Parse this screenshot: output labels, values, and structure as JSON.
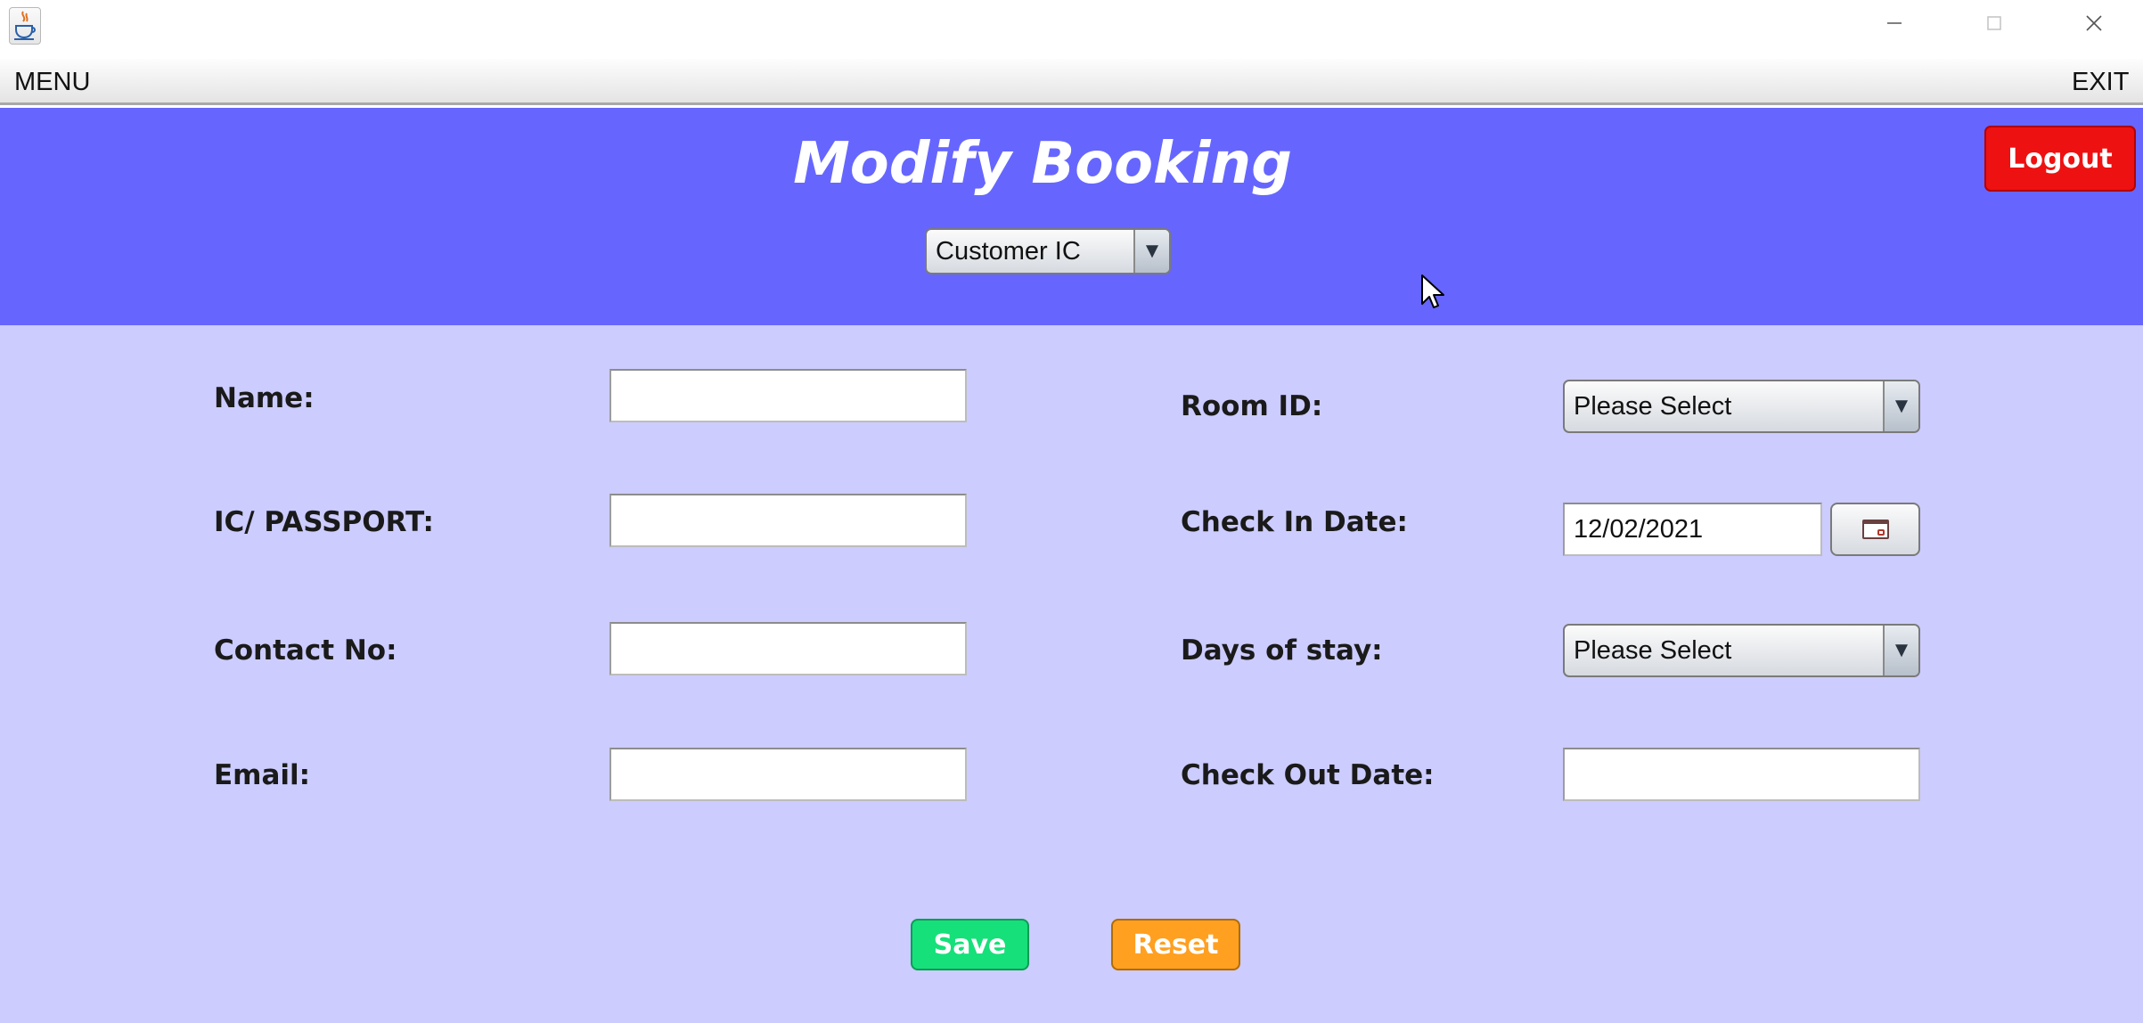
{
  "window": {
    "app_icon": "java-coffee-cup-icon",
    "controls": {
      "minimize": "—",
      "maximize": "☐",
      "close": "✕"
    }
  },
  "menubar": {
    "menu_label": "MENU",
    "exit_label": "EXIT"
  },
  "header": {
    "title": "Modify Booking",
    "logout_label": "Logout",
    "search_type_selected": "Customer IC",
    "bg_color": "#6666ff"
  },
  "form": {
    "bg_color": "#ccccff",
    "name": {
      "label": "Name:",
      "value": ""
    },
    "ic_passport": {
      "label": "IC/ PASSPORT:",
      "value": ""
    },
    "contact_no": {
      "label": "Contact No:",
      "value": ""
    },
    "email": {
      "label": "Email:",
      "value": ""
    },
    "room_id": {
      "label": "Room ID:",
      "selected": "Please Select"
    },
    "check_in_date": {
      "label": "Check In Date:",
      "value": "12/02/2021",
      "picker_icon": "calendar-icon"
    },
    "days_of_stay": {
      "label": "Days of stay:",
      "selected": "Please Select"
    },
    "check_out_date": {
      "label": "Check Out Date:",
      "value": ""
    }
  },
  "actions": {
    "save_label": "Save",
    "save_color": "#16e07a",
    "reset_label": "Reset",
    "reset_color": "#ffa020"
  },
  "colors": {
    "logout": "#ee1111"
  }
}
